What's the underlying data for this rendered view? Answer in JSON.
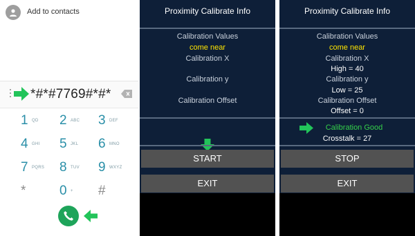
{
  "dialer": {
    "add_contact_label": "Add to contacts",
    "dialed_number": "*#*#7769#*#*",
    "keys": [
      {
        "digit": "1",
        "letters": "QD"
      },
      {
        "digit": "2",
        "letters": "ABC"
      },
      {
        "digit": "3",
        "letters": "DEF"
      },
      {
        "digit": "4",
        "letters": "GHI"
      },
      {
        "digit": "5",
        "letters": "JKL"
      },
      {
        "digit": "6",
        "letters": "MNO"
      },
      {
        "digit": "7",
        "letters": "PQRS"
      },
      {
        "digit": "8",
        "letters": "TUV"
      },
      {
        "digit": "9",
        "letters": "WXYZ"
      },
      {
        "digit": "*",
        "letters": ""
      },
      {
        "digit": "0",
        "letters": "+"
      },
      {
        "digit": "#",
        "letters": ""
      }
    ]
  },
  "panel_a": {
    "title": "Proximity Calibrate Info",
    "calibration_values_label": "Calibration Values",
    "status": "come near",
    "calibration_x_label": "Calibration X",
    "calibration_y_label": "Calibration y",
    "calibration_offset_label": "Calibration Offset",
    "start_button": "START",
    "exit_button": "EXIT"
  },
  "panel_b": {
    "title": "Proximity Calibrate Info",
    "calibration_values_label": "Calibration Values",
    "status": "come near",
    "calibration_x_label": "Calibration X",
    "high_value": "High = 40",
    "calibration_y_label": "Calibration y",
    "low_value": "Low = 25",
    "calibration_offset_label": "Calibration Offset",
    "offset_value": "Offset = 0",
    "result": "Calibration Good",
    "crosstalk_value": "Crosstalk = 27",
    "stop_button": "STOP",
    "exit_button": "EXIT"
  },
  "colors": {
    "panel_background": "#0e1f38",
    "status_yellow": "#ffe600",
    "success_green": "#35d14a",
    "dialer_digit": "#2a8fa8",
    "call_button": "#1ea45a",
    "pointer_arrow": "#22c45a"
  }
}
